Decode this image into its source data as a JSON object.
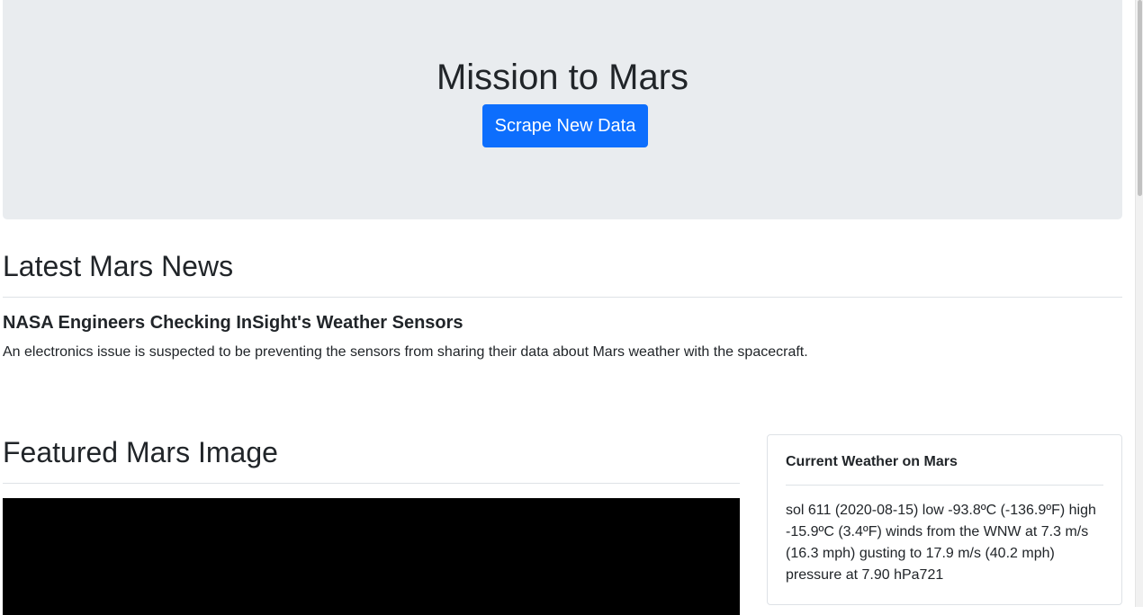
{
  "header": {
    "title": "Mission to Mars",
    "scrape_button_label": "Scrape New Data"
  },
  "news": {
    "section_title": "Latest Mars News",
    "headline": "NASA Engineers Checking InSight's Weather Sensors",
    "teaser": "An electronics issue is suspected to be preventing the sensors from sharing their data about Mars weather with the spacecraft."
  },
  "featured": {
    "section_title": "Featured Mars Image"
  },
  "weather": {
    "title": "Current Weather on Mars",
    "report": "sol 611 (2020-08-15) low -93.8ºC (-136.9ºF) high -15.9ºC (3.4ºF) winds from the WNW at 7.3 m/s (16.3 mph) gusting to 17.9 m/s (40.2 mph) pressure at 7.90 hPa721"
  },
  "colors": {
    "accent": "#0d6efd",
    "jumbotron_bg": "#e9ecef"
  }
}
